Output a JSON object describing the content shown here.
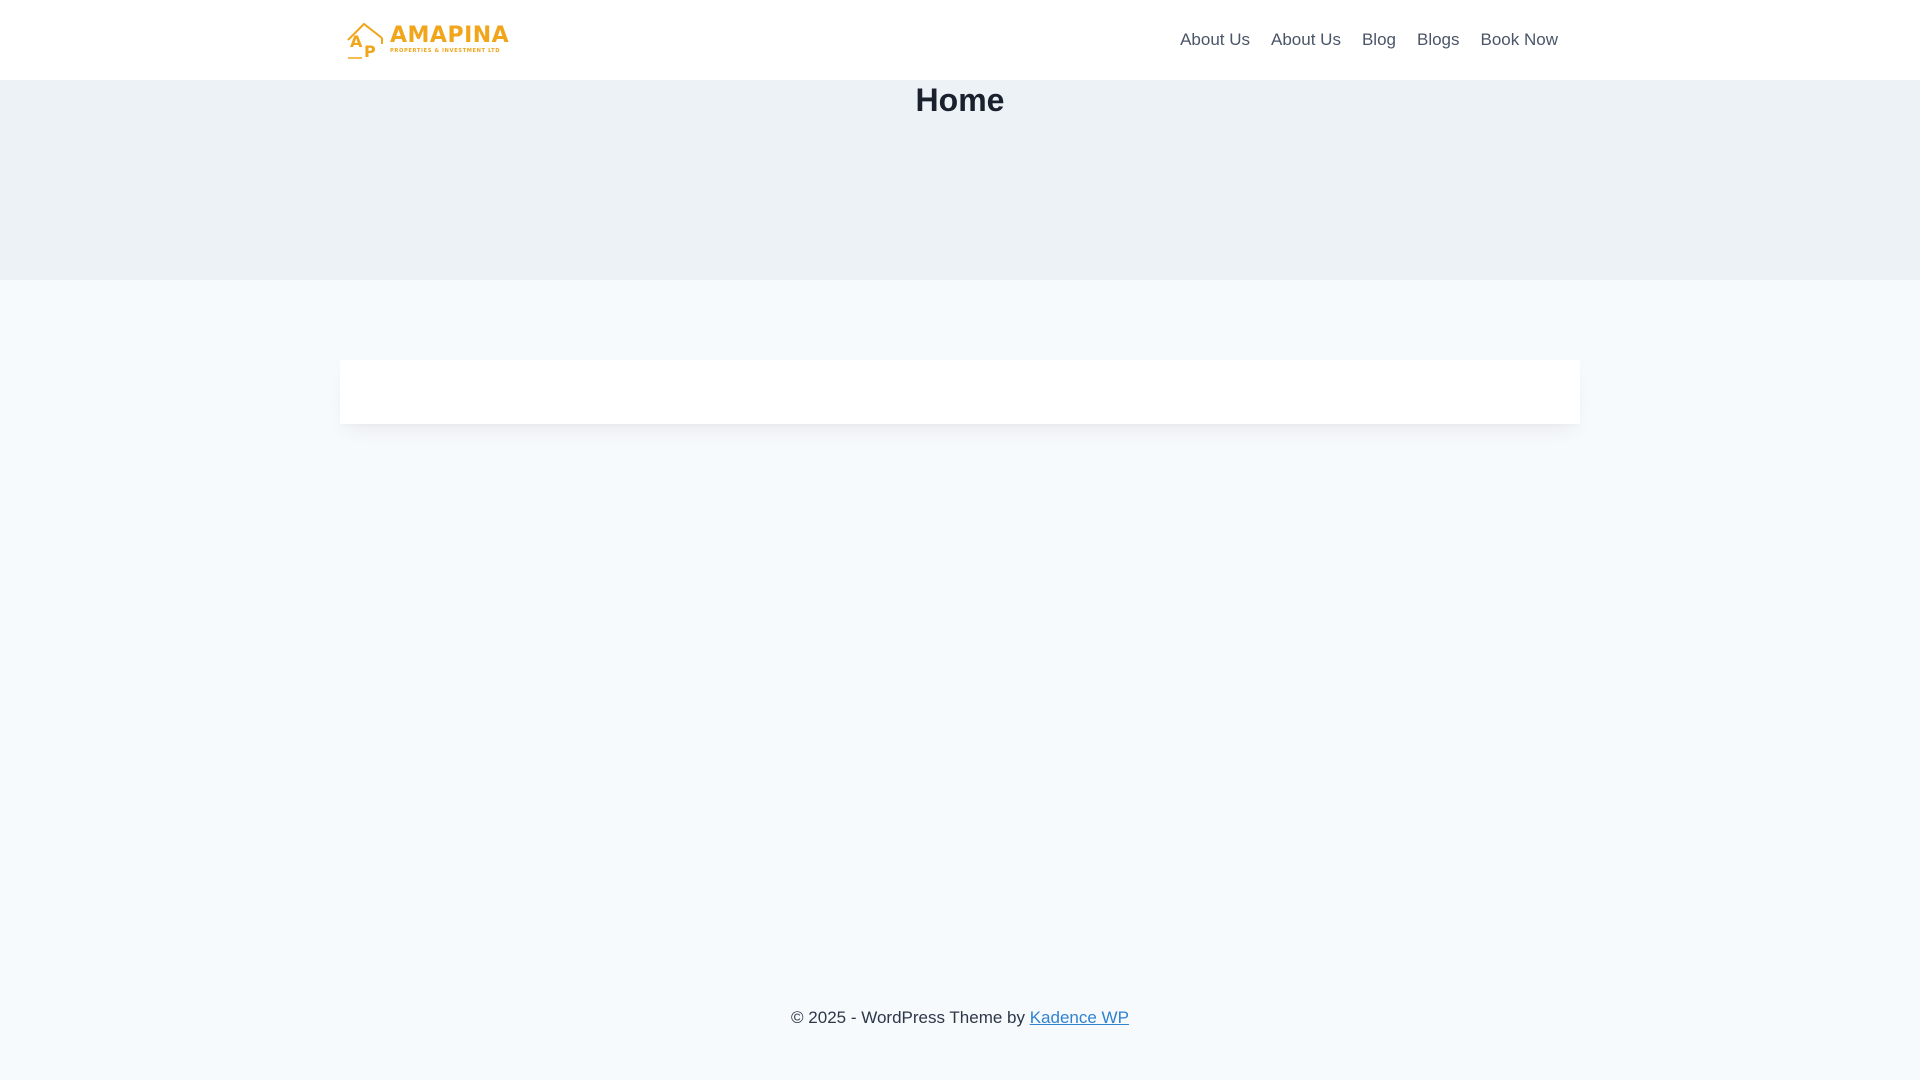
{
  "header": {
    "logo": {
      "mark_letters": [
        "A",
        "P"
      ],
      "name": "AMAPINA",
      "tagline": "PROPERTIES & INVESTMENT LTD",
      "color": "#f0a51b"
    },
    "nav": [
      {
        "label": "About Us"
      },
      {
        "label": "About Us"
      },
      {
        "label": "Blog"
      },
      {
        "label": "Blogs"
      },
      {
        "label": "Book Now"
      }
    ]
  },
  "main": {
    "title": "Home"
  },
  "footer": {
    "text": "© 2025 - WordPress Theme by ",
    "link_label": "Kadence WP",
    "link_color": "#3182ce"
  }
}
